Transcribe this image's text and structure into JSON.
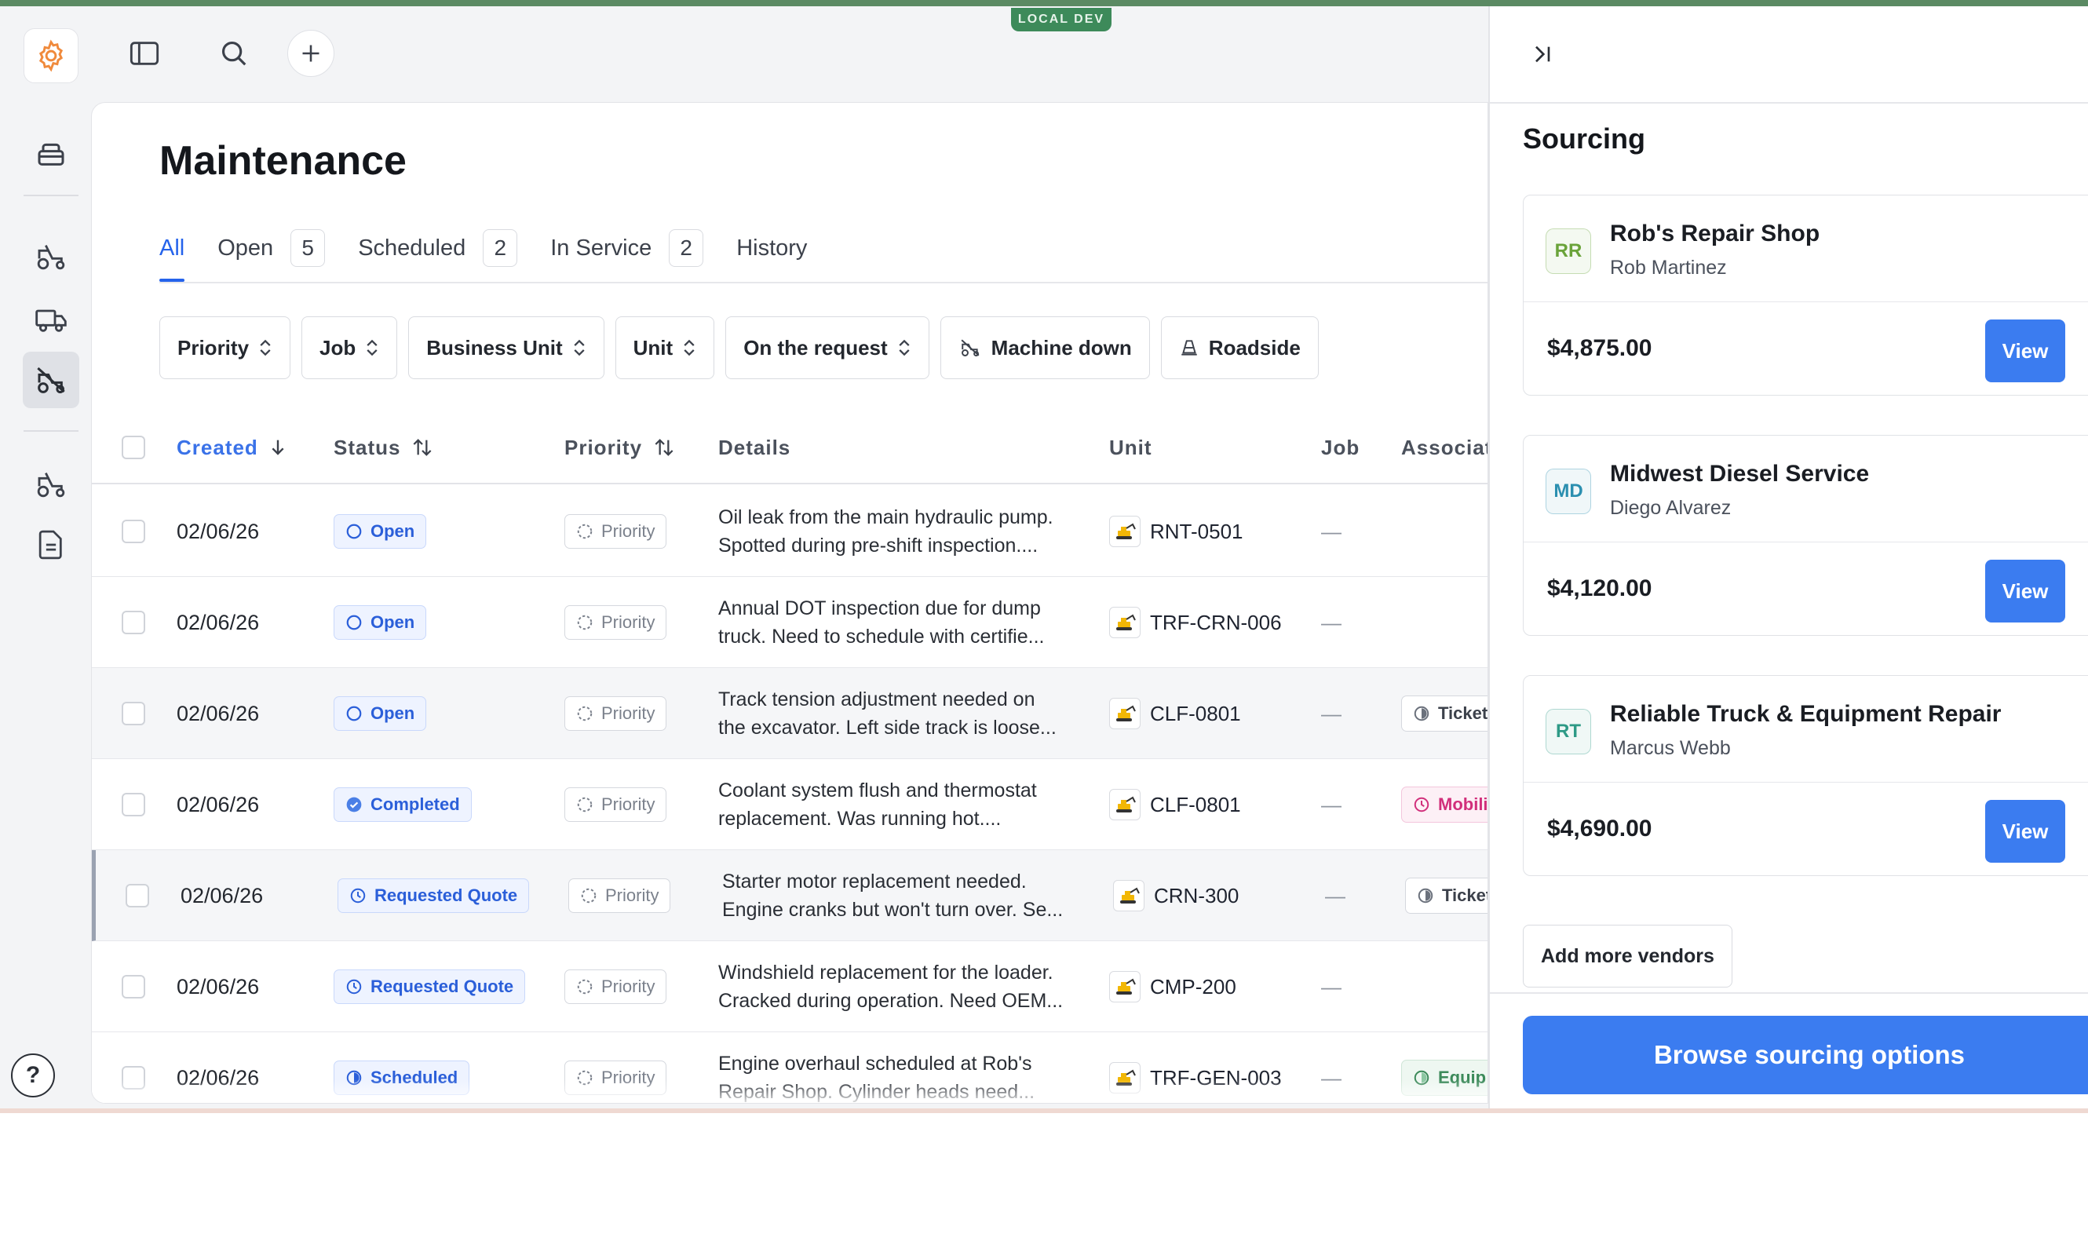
{
  "env_badge": "LOCAL DEV",
  "page": {
    "title": "Maintenance",
    "tabs": [
      {
        "label": "All",
        "count": null,
        "active": true
      },
      {
        "label": "Open",
        "count": "5"
      },
      {
        "label": "Scheduled",
        "count": "2"
      },
      {
        "label": "In Service",
        "count": "2"
      },
      {
        "label": "History",
        "count": null
      }
    ],
    "filters": [
      {
        "label": "Priority",
        "icon": "chevron-updown-icon"
      },
      {
        "label": "Job",
        "icon": "chevron-updown-icon"
      },
      {
        "label": "Business Unit",
        "icon": "chevron-updown-icon"
      },
      {
        "label": "Unit",
        "icon": "chevron-updown-icon"
      },
      {
        "label": "On the request",
        "icon": "chevron-updown-icon"
      },
      {
        "label": "Machine down",
        "icon": "machine-down-icon"
      },
      {
        "label": "Roadside",
        "icon": "cone-icon"
      }
    ]
  },
  "table": {
    "columns": [
      "Created",
      "Status",
      "Priority",
      "Details",
      "Unit",
      "Job",
      "Associat"
    ],
    "rows": [
      {
        "created": "02/06/26",
        "status": "Open",
        "priority": "Priority",
        "details_1": "Oil leak from the main hydraulic pump.",
        "details_2": "Spotted during pre-shift inspection....",
        "unit": "RNT-0501",
        "job": "—",
        "assoc": ""
      },
      {
        "created": "02/06/26",
        "status": "Open",
        "priority": "Priority",
        "details_1": "Annual DOT inspection due for dump",
        "details_2": "truck. Need to schedule with certifie...",
        "unit": "TRF-CRN-006",
        "job": "—",
        "assoc": ""
      },
      {
        "created": "02/06/26",
        "status": "Open",
        "priority": "Priority",
        "details_1": "Track tension adjustment needed on",
        "details_2": "the excavator. Left side track is loose...",
        "unit": "CLF-0801",
        "job": "—",
        "assoc": "Ticket"
      },
      {
        "created": "02/06/26",
        "status": "Completed",
        "priority": "Priority",
        "details_1": "Coolant system flush and thermostat",
        "details_2": "replacement. Was running hot....",
        "unit": "CLF-0801",
        "job": "—",
        "assoc": "Mobili"
      },
      {
        "created": "02/06/26",
        "status": "Requested Quote",
        "priority": "Priority",
        "details_1": "Starter motor replacement needed.",
        "details_2": "Engine cranks but won't turn over. Se...",
        "unit": "CRN-300",
        "job": "—",
        "assoc": "Ticket"
      },
      {
        "created": "02/06/26",
        "status": "Requested Quote",
        "priority": "Priority",
        "details_1": "Windshield replacement for the loader.",
        "details_2": "Cracked during operation. Need OEM...",
        "unit": "CMP-200",
        "job": "—",
        "assoc": ""
      },
      {
        "created": "02/06/26",
        "status": "Scheduled",
        "priority": "Priority",
        "details_1": "Engine overhaul scheduled at Rob's",
        "details_2": "Repair Shop. Cylinder heads need...",
        "unit": "TRF-GEN-003",
        "job": "—",
        "assoc": "Equip"
      }
    ]
  },
  "panel": {
    "title": "Sourcing",
    "vendors": [
      {
        "initials": "RR",
        "name": "Rob's Repair Shop",
        "contact": "Rob Martinez",
        "price": "$4,875.00",
        "action": "View",
        "color": "#6aa33a"
      },
      {
        "initials": "MD",
        "name": "Midwest Diesel Service",
        "contact": "Diego Alvarez",
        "price": "$4,120.00",
        "action": "View",
        "color": "#2b8fb0"
      },
      {
        "initials": "RT",
        "name": "Reliable Truck & Equipment Repair",
        "contact": "Marcus Webb",
        "price": "$4,690.00",
        "action": "View",
        "color": "#2e9a86"
      }
    ],
    "add_more": "Add more vendors",
    "browse": "Browse sourcing options"
  },
  "colors": {
    "accent": "#3b7cf0",
    "env": "#3d8a5a",
    "logo": "#f08a3c"
  }
}
